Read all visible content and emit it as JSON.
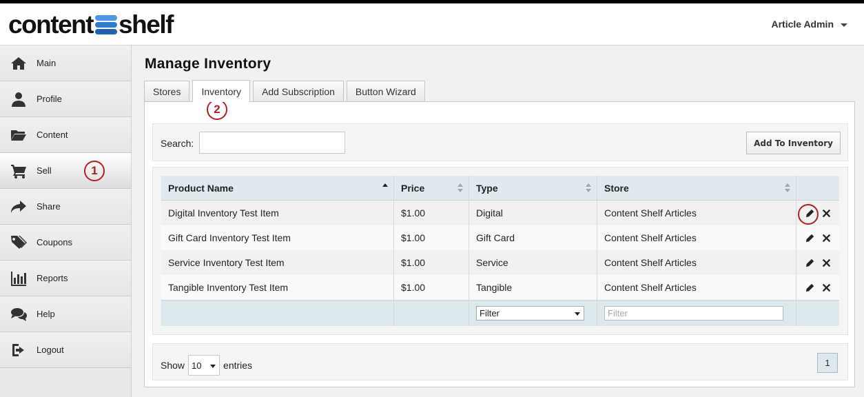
{
  "brand": {
    "logo_left": "content",
    "logo_right": "shelf"
  },
  "header": {
    "user_label": "Article Admin"
  },
  "sidebar": {
    "items": [
      {
        "label": "Main",
        "icon": "home-icon"
      },
      {
        "label": "Profile",
        "icon": "user-icon"
      },
      {
        "label": "Content",
        "icon": "folder-open-icon"
      },
      {
        "label": "Sell",
        "icon": "cart-icon",
        "active": true
      },
      {
        "label": "Share",
        "icon": "share-icon"
      },
      {
        "label": "Coupons",
        "icon": "tags-icon"
      },
      {
        "label": "Reports",
        "icon": "bar-chart-icon"
      },
      {
        "label": "Help",
        "icon": "chat-bubbles-icon"
      },
      {
        "label": "Logout",
        "icon": "logout-icon"
      }
    ]
  },
  "callouts": {
    "one": "1",
    "two": "2"
  },
  "main": {
    "title": "Manage Inventory",
    "tabs": [
      {
        "label": "Stores"
      },
      {
        "label": "Inventory",
        "active": true
      },
      {
        "label": "Add Subscription"
      },
      {
        "label": "Button Wizard"
      }
    ],
    "search": {
      "label": "Search:",
      "value": "",
      "placeholder": ""
    },
    "add_button": "Add To Inventory",
    "table": {
      "columns": [
        "Product Name",
        "Price",
        "Type",
        "Store"
      ],
      "rows": [
        {
          "name": "Digital Inventory Test Item",
          "price": "$1.00",
          "type": "Digital",
          "store": "Content Shelf Articles"
        },
        {
          "name": "Gift Card Inventory Test Item",
          "price": "$1.00",
          "type": "Gift Card",
          "store": "Content Shelf Articles"
        },
        {
          "name": "Service Inventory Test Item",
          "price": "$1.00",
          "type": "Service",
          "store": "Content Shelf Articles"
        },
        {
          "name": "Tangible Inventory Test Item",
          "price": "$1.00",
          "type": "Tangible",
          "store": "Content Shelf Articles"
        }
      ],
      "type_filter": "Filter",
      "store_filter_placeholder": "Filter"
    },
    "footer": {
      "show_label": "Show",
      "page_length": "10",
      "entries_label": "entries",
      "page": "1"
    }
  },
  "colors": {
    "callout": "#b51d24",
    "logo_blue": "#2f7bd0",
    "table_header": "#dfe9ee"
  }
}
